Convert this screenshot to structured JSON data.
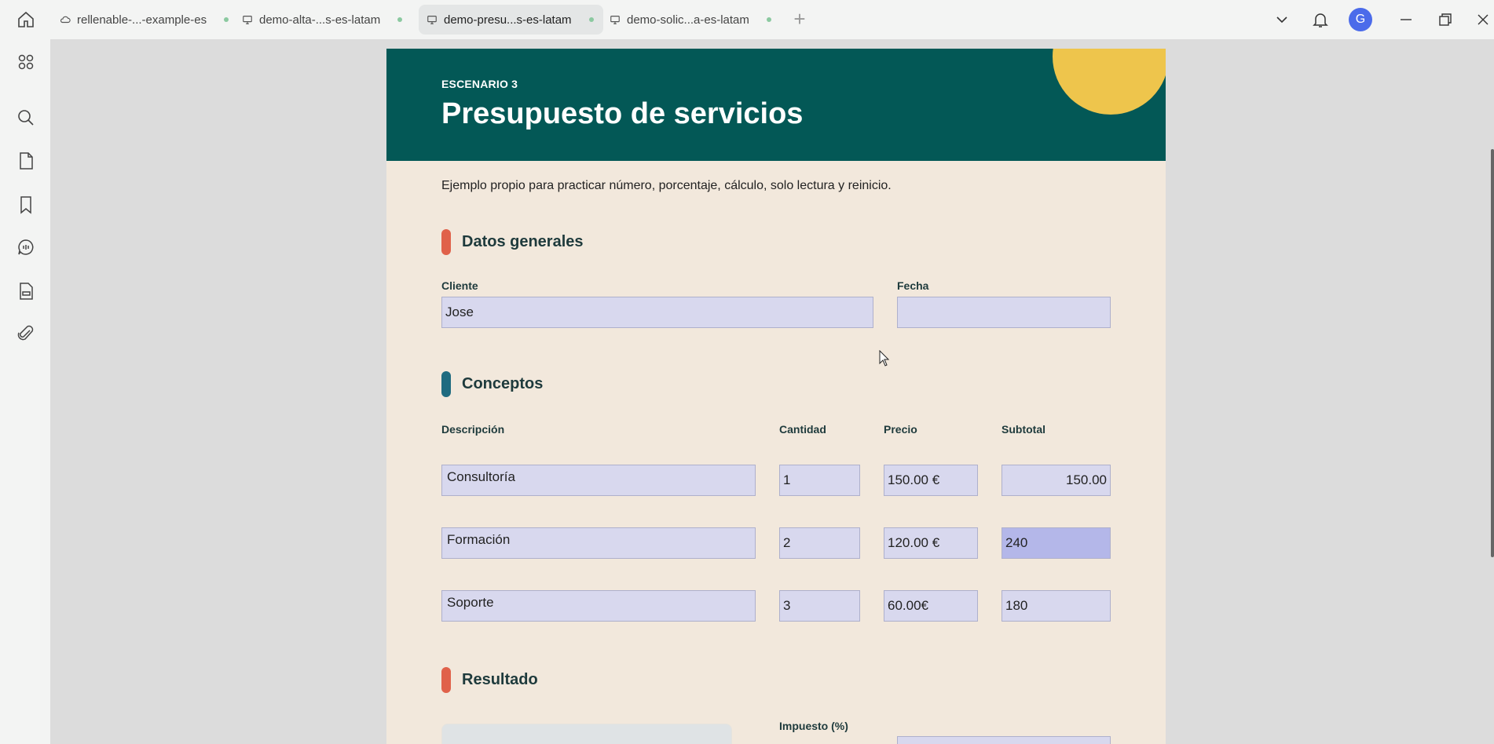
{
  "tabs": [
    {
      "label": "rellenable-...-example-es",
      "icon": "cloud-icon",
      "active": false
    },
    {
      "label": "demo-alta-...s-es-latam",
      "icon": "monitor-icon",
      "active": false
    },
    {
      "label": "demo-presu...s-es-latam",
      "icon": "monitor-icon",
      "active": true
    },
    {
      "label": "demo-solic...a-es-latam",
      "icon": "monitor-icon",
      "active": false
    }
  ],
  "user": {
    "avatar_initial": "G"
  },
  "document": {
    "eyebrow": "ESCENARIO 3",
    "title": "Presupuesto de servicios",
    "subtitle": "Ejemplo propio para practicar número, porcentaje, cálculo, solo lectura y reinicio.",
    "sections": {
      "general": "Datos generales",
      "concepts": "Conceptos",
      "result": "Resultado"
    },
    "general": {
      "client_label": "Cliente",
      "client_value": "Jose",
      "date_label": "Fecha",
      "date_value": ""
    },
    "concepts": {
      "headers": {
        "description": "Descripción",
        "quantity": "Cantidad",
        "price": "Precio",
        "subtotal": "Subtotal"
      },
      "rows": [
        {
          "description": "Consultoría",
          "quantity": "1",
          "price": "150.00 €",
          "subtotal": "150.00"
        },
        {
          "description": "Formación",
          "quantity": "2",
          "price": "120.00 €",
          "subtotal": "240"
        },
        {
          "description": "Soporte",
          "quantity": "3",
          "price": "60.00€",
          "subtotal": "180"
        }
      ]
    },
    "result": {
      "tax_label": "Impuesto (%)"
    }
  },
  "colors": {
    "header_bg": "#035856",
    "accent_circle": "#eec54c",
    "section_red": "#e0614a",
    "section_teal": "#1f6b80",
    "page_bg": "#f2e8dc",
    "field_bg": "#d8d8ee"
  }
}
